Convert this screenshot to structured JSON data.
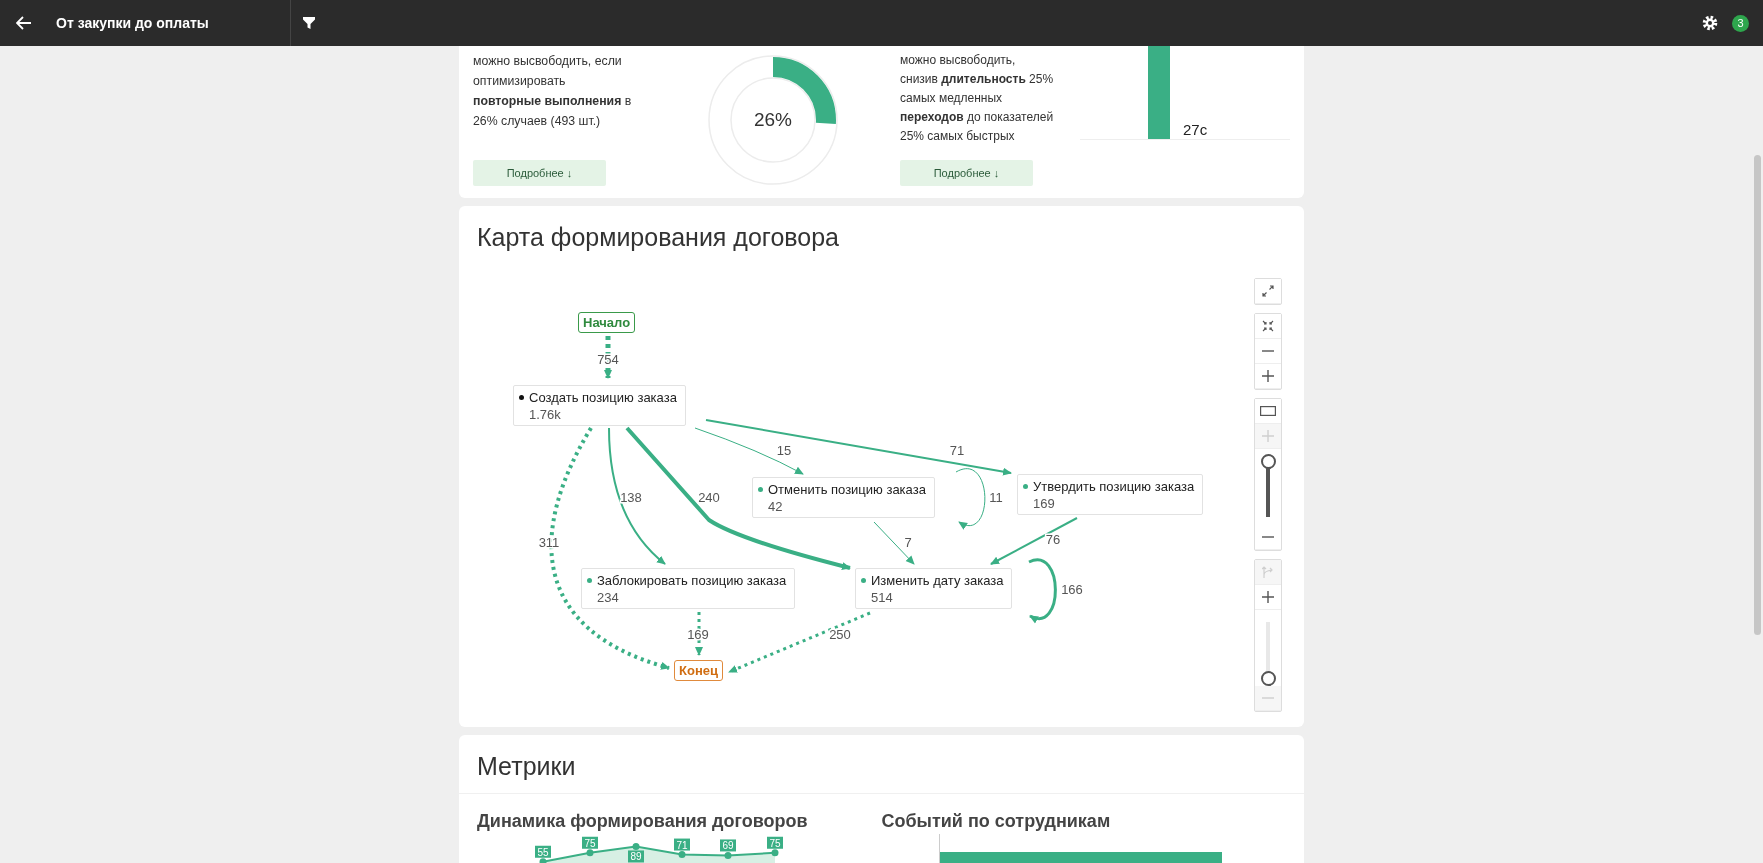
{
  "app_bar": {
    "title": "От закупки до оплаты",
    "notification_count": "3"
  },
  "insights": [
    {
      "kind": "donut",
      "text": "можно высвободить, если оптимизировать **повторные выполнения** в 26% случаев (493 шт.)",
      "donut": {
        "label": "26%",
        "level": 0.26
      },
      "button": "Подробнее ↓"
    },
    {
      "kind": "bar",
      "text": "можно высвободить, снизив **длительность** 25% самых медленных **переходов** до показателей 25% самых быстрых",
      "bar_label": "27с",
      "button": "Подробнее ↓"
    }
  ],
  "process_map": {
    "title": "Карта формирования договора",
    "nodes": [
      {
        "kind": "start",
        "label": "Начало"
      },
      {
        "kind": "activity",
        "label": "Создать позицию заказа",
        "count": "1.76k",
        "color": "#111111"
      },
      {
        "kind": "activity",
        "label": "Отменить позицию заказа",
        "count": "42",
        "color": "#3aaf85"
      },
      {
        "kind": "activity",
        "label": "Утвердить позицию заказа",
        "count": "169",
        "color": "#3aaf85"
      },
      {
        "kind": "activity",
        "label": "Заблокировать позицию заказа",
        "count": "234",
        "color": "#3aaf85"
      },
      {
        "kind": "activity",
        "label": "Изменить дату заказа",
        "count": "514",
        "color": "#3aaf85"
      },
      {
        "kind": "end",
        "label": "Конец"
      }
    ],
    "edges": [
      {
        "label": "754",
        "kind": "dashed"
      },
      {
        "label": "15",
        "kind": "solid"
      },
      {
        "label": "71",
        "kind": "solid"
      },
      {
        "label": "138",
        "kind": "solid"
      },
      {
        "label": "240",
        "kind": "solid"
      },
      {
        "label": "311",
        "kind": "dotted"
      },
      {
        "label": "11",
        "kind": "solid"
      },
      {
        "label": "7",
        "kind": "solid"
      },
      {
        "label": "76",
        "kind": "solid"
      },
      {
        "label": "166",
        "kind": "solid"
      },
      {
        "label": "169",
        "kind": "dotted"
      },
      {
        "label": "250",
        "kind": "dotted"
      }
    ],
    "control_groups": [
      [
        {
          "kind": "expand",
          "disabled": false
        }
      ],
      [
        {
          "kind": "shrink",
          "disabled": false
        },
        {
          "kind": "minus",
          "disabled": false
        },
        {
          "kind": "plus",
          "disabled": false
        }
      ],
      [
        {
          "kind": "frame",
          "disabled": false
        },
        {
          "kind": "plus",
          "disabled": true
        },
        {
          "kind": "slider",
          "level": 1
        },
        {
          "kind": "minus",
          "disabled": false
        }
      ],
      [
        {
          "kind": "branch",
          "disabled": true
        },
        {
          "kind": "plus",
          "disabled": false
        },
        {
          "kind": "slider",
          "level": 0
        },
        {
          "kind": "minus",
          "disabled": true
        }
      ]
    ]
  },
  "metrics": {
    "title": "Метрики",
    "panels": [
      {
        "kind": "line",
        "title": "Динамика формирования договоров",
        "chart_data": {
          "type": "area",
          "categories": [
            null,
            null,
            null,
            null,
            null,
            null
          ],
          "series": [
            {
              "color": "#3aaf85",
              "marker": true,
              "values": [
                55,
                75,
                89,
                71,
                69,
                75
              ]
            }
          ],
          "data_labels": true
        }
      },
      {
        "kind": "bar",
        "title": "Событий по сотрудникам"
      }
    ]
  }
}
